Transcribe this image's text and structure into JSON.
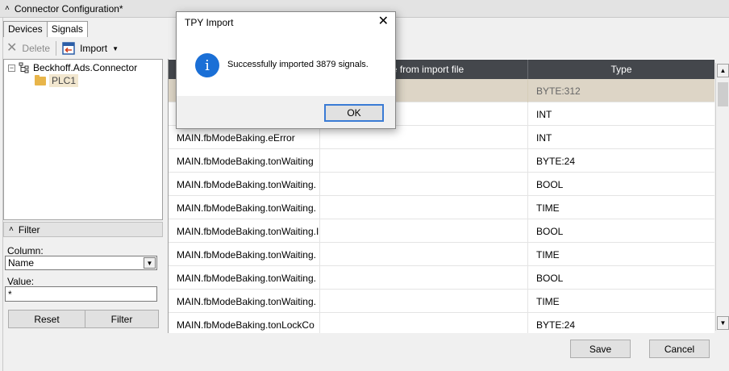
{
  "window": {
    "title": "Connector Configuration*"
  },
  "tabs": [
    {
      "label": "Devices",
      "active": false
    },
    {
      "label": "Signals",
      "active": true
    }
  ],
  "toolbar": {
    "delete_label": "Delete",
    "import_label": "Import"
  },
  "tree": {
    "root": "Beckhoff.Ads.Connector",
    "child": "PLC1"
  },
  "filter": {
    "header": "Filter",
    "column_label": "Column:",
    "column_value": "Name",
    "value_label": "Value:",
    "value": "*",
    "reset_label": "Reset",
    "filter_label": "Filter"
  },
  "grid": {
    "columns": [
      "",
      "me from import file",
      "Type"
    ],
    "rows": [
      {
        "name": "",
        "import_name": "",
        "type": "BYTE:312",
        "selected": true
      },
      {
        "name": "",
        "import_name": "",
        "type": "INT"
      },
      {
        "name": "MAIN.fbModeBaking.eError",
        "import_name": "",
        "type": "INT"
      },
      {
        "name": "MAIN.fbModeBaking.tonWaiting",
        "import_name": "",
        "type": "BYTE:24"
      },
      {
        "name": "MAIN.fbModeBaking.tonWaiting.",
        "import_name": "",
        "type": "BOOL"
      },
      {
        "name": "MAIN.fbModeBaking.tonWaiting.",
        "import_name": "",
        "type": "TIME"
      },
      {
        "name": "MAIN.fbModeBaking.tonWaiting.I",
        "import_name": "",
        "type": "BOOL"
      },
      {
        "name": "MAIN.fbModeBaking.tonWaiting.",
        "import_name": "",
        "type": "TIME"
      },
      {
        "name": "MAIN.fbModeBaking.tonWaiting.",
        "import_name": "",
        "type": "BOOL"
      },
      {
        "name": "MAIN.fbModeBaking.tonWaiting.",
        "import_name": "",
        "type": "TIME"
      },
      {
        "name": "MAIN.fbModeBaking.tonLockCo",
        "import_name": "",
        "type": "BYTE:24"
      }
    ]
  },
  "footer": {
    "save_label": "Save",
    "cancel_label": "Cancel"
  },
  "dialog": {
    "title": "TPY Import",
    "icon": "info-icon",
    "message": "Successfully imported 3879 signals.",
    "ok_label": "OK"
  },
  "colors": {
    "grid_header_bg": "#44474c",
    "selected_row_bg": "#ddd5c6",
    "info_icon": "#1a6fd6",
    "default_button_border": "#3a7bd5"
  }
}
